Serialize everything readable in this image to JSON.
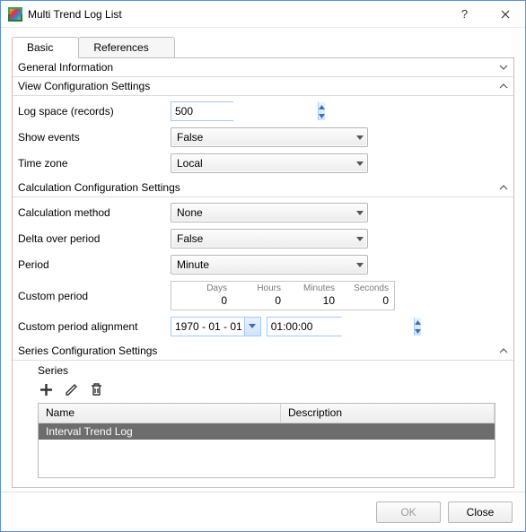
{
  "window": {
    "title": "Multi Trend Log List",
    "help_label": "?",
    "close_label": "✕"
  },
  "tabs": [
    {
      "id": "basic",
      "label": "Basic",
      "active": true
    },
    {
      "id": "references",
      "label": "References",
      "active": false
    }
  ],
  "sections": {
    "general": {
      "title": "General Information",
      "expanded": false
    },
    "view": {
      "title": "View Configuration Settings",
      "expanded": true,
      "fields": {
        "log_space_label": "Log space (records)",
        "log_space_value": "500",
        "show_events_label": "Show events",
        "show_events_value": "False",
        "time_zone_label": "Time zone",
        "time_zone_value": "Local"
      }
    },
    "calc": {
      "title": "Calculation Configuration Settings",
      "expanded": true,
      "fields": {
        "method_label": "Calculation method",
        "method_value": "None",
        "delta_label": "Delta over period",
        "delta_value": "False",
        "period_label": "Period",
        "period_value": "Minute",
        "custom_label": "Custom period",
        "custom": {
          "days_label": "Days",
          "days_value": "0",
          "hours_label": "Hours",
          "hours_value": "0",
          "minutes_label": "Minutes",
          "minutes_value": "10",
          "seconds_label": "Seconds",
          "seconds_value": "0"
        },
        "align_label": "Custom period alignment",
        "align_date": "1970 - 01 - 01",
        "align_time": "01:00:00"
      }
    },
    "series": {
      "title": "Series Configuration Settings",
      "expanded": true,
      "subtitle": "Series",
      "columns": {
        "name": "Name",
        "description": "Description"
      },
      "rows": [
        {
          "name": "Interval Trend Log",
          "description": ""
        }
      ]
    }
  },
  "footer": {
    "ok_label": "OK",
    "close_label": "Close"
  }
}
